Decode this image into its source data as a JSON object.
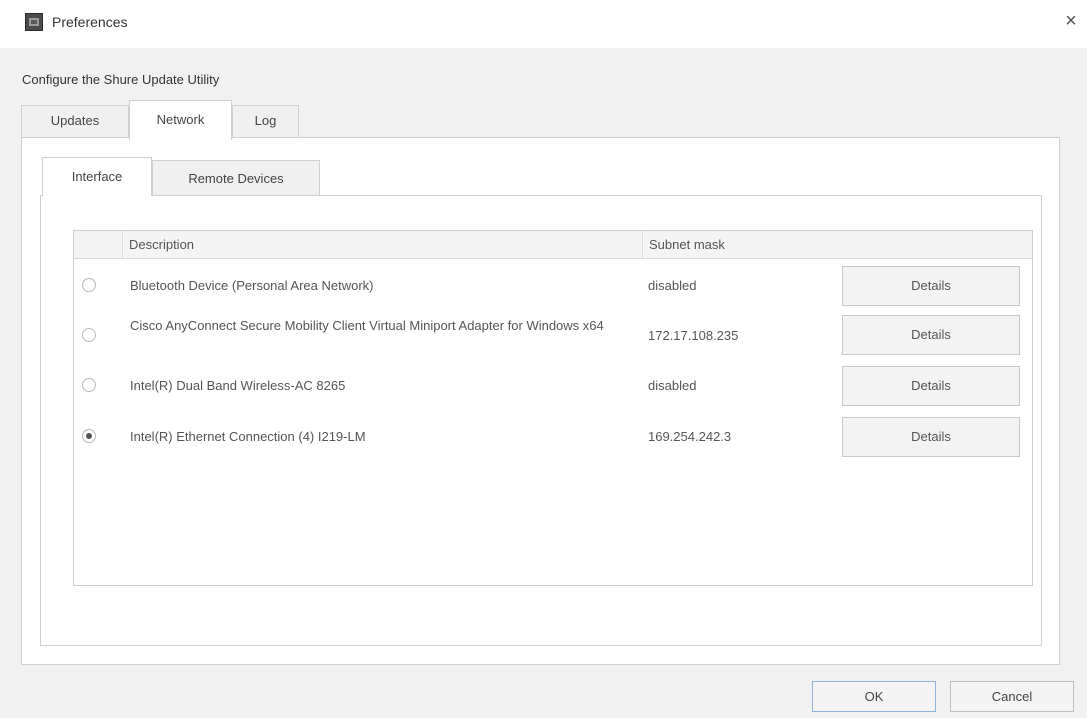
{
  "window": {
    "title": "Preferences",
    "subtitle": "Configure the Shure Update Utility"
  },
  "icons": {
    "app": "app-icon",
    "close": "close-icon"
  },
  "close_glyph": "×",
  "tabs": [
    {
      "label": "Updates",
      "selected": false
    },
    {
      "label": "Network",
      "selected": true
    },
    {
      "label": "Log",
      "selected": false
    }
  ],
  "subtabs": [
    {
      "label": "Interface",
      "selected": true
    },
    {
      "label": "Remote Devices",
      "selected": false
    }
  ],
  "table": {
    "columns": [
      "Description",
      "Subnet mask"
    ],
    "rows": [
      {
        "selected": false,
        "description": "Bluetooth Device (Personal Area Network)",
        "subnet_mask": "disabled",
        "action": "Details"
      },
      {
        "selected": false,
        "description": "Cisco AnyConnect Secure Mobility Client Virtual Miniport Adapter for Windows x64",
        "subnet_mask": "172.17.108.235",
        "action": "Details"
      },
      {
        "selected": false,
        "description": "Intel(R) Dual Band Wireless-AC 8265",
        "subnet_mask": "disabled",
        "action": "Details"
      },
      {
        "selected": true,
        "description": "Intel(R) Ethernet Connection (4) I219-LM",
        "subnet_mask": "169.254.242.3",
        "action": "Details"
      }
    ]
  },
  "buttons": {
    "ok": "OK",
    "cancel": "Cancel"
  }
}
